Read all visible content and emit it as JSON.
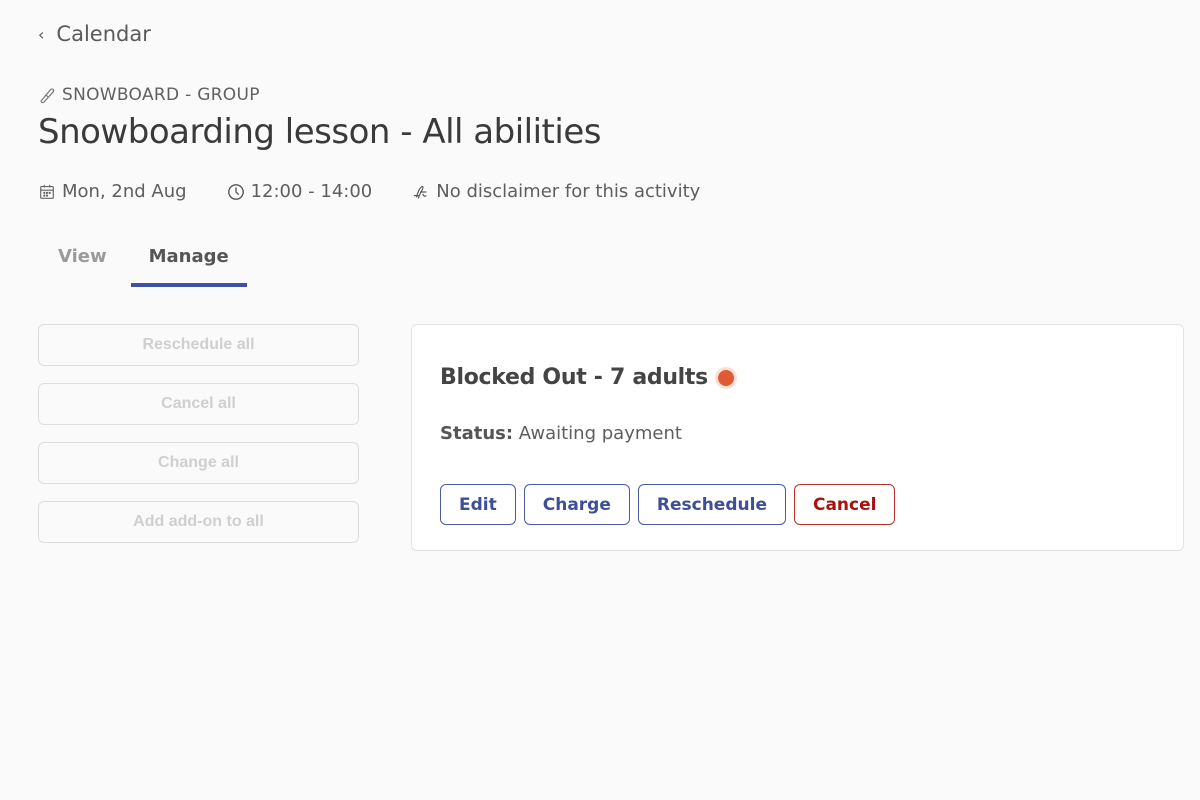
{
  "nav": {
    "back_label": "Calendar"
  },
  "activity": {
    "category": "SNOWBOARD - GROUP",
    "title": "Snowboarding lesson - All abilities",
    "date": "Mon, 2nd Aug",
    "time": "12:00 - 14:00",
    "disclaimer": "No disclaimer for this activity"
  },
  "tabs": [
    {
      "label": "View",
      "active": false
    },
    {
      "label": "Manage",
      "active": true
    }
  ],
  "bulk_actions": [
    {
      "label": "Reschedule all",
      "disabled": true
    },
    {
      "label": "Cancel all",
      "disabled": true
    },
    {
      "label": "Change all",
      "disabled": true
    },
    {
      "label": "Add add-on to all",
      "disabled": true
    }
  ],
  "booking": {
    "title": "Blocked Out - 7 adults",
    "status_label": "Status:",
    "status_value": "Awaiting payment",
    "status_dot_color": "#e05a33",
    "actions": [
      {
        "label": "Edit"
      },
      {
        "label": "Charge"
      },
      {
        "label": "Reschedule"
      },
      {
        "label": "Cancel"
      }
    ]
  },
  "colors": {
    "accent": "#3f51a3",
    "danger": "#a8120e"
  }
}
